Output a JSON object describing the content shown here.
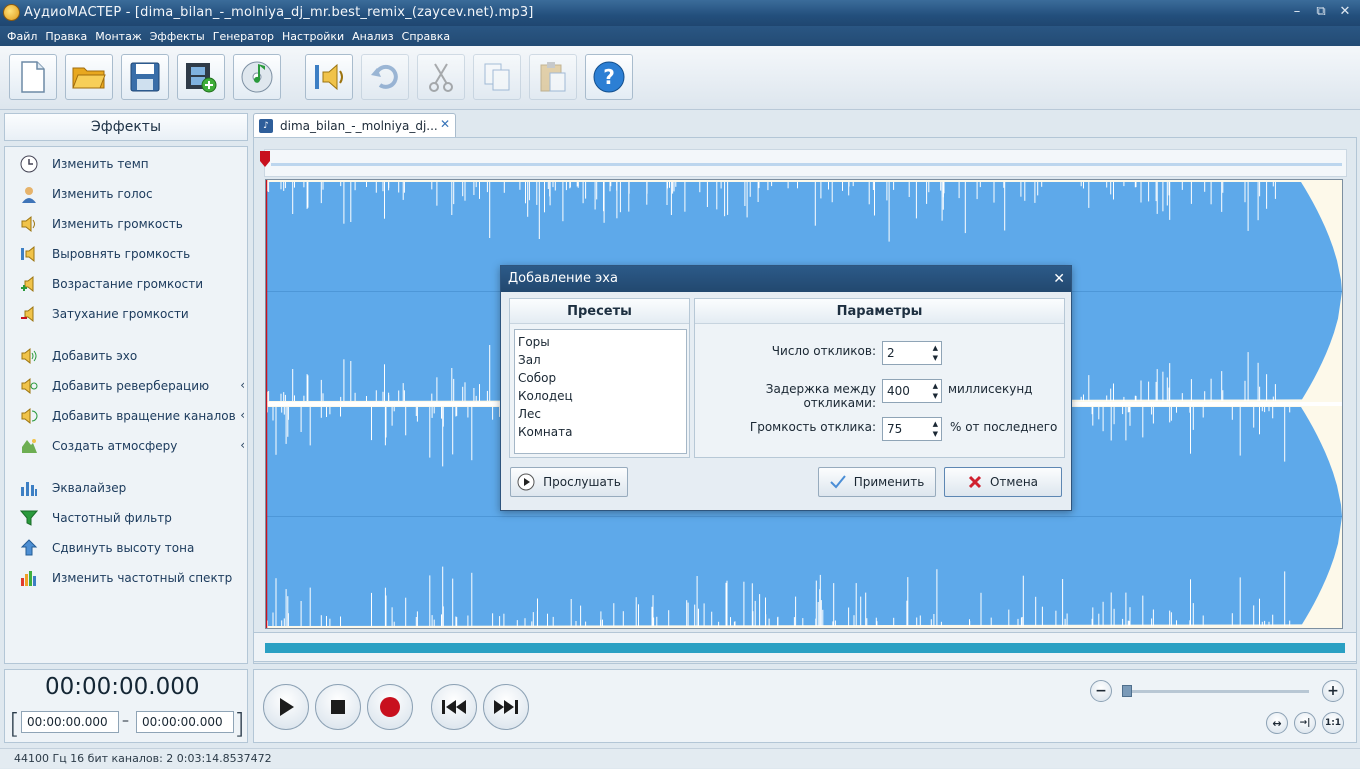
{
  "window": {
    "title": "АудиоМАСТЕР - [dima_bilan_-_molniya_dj_mr.best_remix_(zaycev.net).mp3]",
    "minimize": "–",
    "maximize": "⧉",
    "close": "✕"
  },
  "menu": [
    "Файл",
    "Правка",
    "Монтаж",
    "Эффекты",
    "Генератор",
    "Настройки",
    "Анализ",
    "Справка"
  ],
  "toolbar": {
    "buttons": [
      {
        "icon": "new-file-icon",
        "enabled": true
      },
      {
        "icon": "open-folder-icon",
        "enabled": true
      },
      {
        "icon": "save-icon",
        "enabled": true
      },
      {
        "icon": "add-video-icon",
        "enabled": true
      },
      {
        "icon": "cd-icon",
        "enabled": true
      },
      {
        "icon": "audio-properties-icon",
        "enabled": true
      },
      {
        "icon": "undo-icon",
        "enabled": false
      },
      {
        "icon": "cut-icon",
        "enabled": false
      },
      {
        "icon": "copy-icon",
        "enabled": false
      },
      {
        "icon": "paste-icon",
        "enabled": false
      },
      {
        "icon": "help-icon",
        "enabled": true
      }
    ]
  },
  "sidebar": {
    "header": "Эффекты",
    "items": [
      {
        "label": "Изменить темп",
        "icon": "clock-icon",
        "submenu": false
      },
      {
        "label": "Изменить голос",
        "icon": "person-icon",
        "submenu": false
      },
      {
        "label": "Изменить громкость",
        "icon": "speaker-icon",
        "submenu": false
      },
      {
        "label": "Выровнять громкость",
        "icon": "speaker-level-icon",
        "submenu": false
      },
      {
        "label": "Возрастание громкости",
        "icon": "speaker-plus-icon",
        "submenu": false
      },
      {
        "label": "Затухание громкости",
        "icon": "speaker-minus-icon",
        "submenu": false
      },
      {
        "label": "Добавить эхо",
        "icon": "echo-icon",
        "submenu": false
      },
      {
        "label": "Добавить реверберацию",
        "icon": "reverb-icon",
        "submenu": true
      },
      {
        "label": "Добавить вращение каналов",
        "icon": "rotate-channels-icon",
        "submenu": true
      },
      {
        "label": "Создать атмосферу",
        "icon": "atmosphere-icon",
        "submenu": true
      },
      {
        "label": "Эквалайзер",
        "icon": "equalizer-icon",
        "submenu": false
      },
      {
        "label": "Частотный фильтр",
        "icon": "funnel-icon",
        "submenu": false
      },
      {
        "label": "Сдвинуть высоту тона",
        "icon": "pitch-arrow-icon",
        "submenu": false
      },
      {
        "label": "Изменить частотный спектр",
        "icon": "spectrum-icon",
        "submenu": false
      }
    ]
  },
  "tab": {
    "label": "dima_bilan_-_molniya_dj...",
    "close": "✕"
  },
  "colors": {
    "waveform": "#5ea9ea",
    "waveform_bg": "#fdf9ea",
    "scroll_thumb": "#2aa0c3",
    "record": "#c8101e"
  },
  "time": {
    "current": "00:00:00.000",
    "start": "00:00:00.000",
    "end": "00:00:00.000",
    "separator": "–"
  },
  "transport": {
    "buttons": [
      "play-icon",
      "stop-icon",
      "record-icon",
      "rewind-icon",
      "fast-forward-icon"
    ],
    "zoom_level": 0.0,
    "zoom_out": "−",
    "zoom_in": "+",
    "fit_label": "↔",
    "zoom_sel_label": "→|",
    "one_to_one": "1:1"
  },
  "status": "44100 Гц  16 бит  каналов: 2    0:03:14.8537472",
  "dialog": {
    "title": "Добавление эха",
    "close": "✕",
    "presets_header": "Пресеты",
    "presets": [
      "Горы",
      "Зал",
      "Собор",
      "Колодец",
      "Лес",
      "Комната"
    ],
    "params_header": "Параметры",
    "params": [
      {
        "label": "Число откликов:",
        "value": "2",
        "unit": ""
      },
      {
        "label": "Задержка между откликами:",
        "value": "400",
        "unit": "миллисекунд"
      },
      {
        "label": "Громкость отклика:",
        "value": "75",
        "unit": "% от последнего"
      }
    ],
    "listen_button": "Прослушать",
    "apply_button": "Применить",
    "cancel_button": "Отмена"
  }
}
